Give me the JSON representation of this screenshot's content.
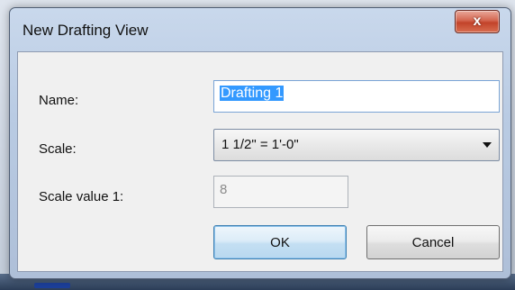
{
  "dialog": {
    "title": "New Drafting View",
    "close_glyph": "x"
  },
  "form": {
    "name_label": "Name:",
    "name_value": "Drafting 1",
    "scale_label": "Scale:",
    "scale_value": "1 1/2\" = 1'-0\"",
    "scale_value_label": "Scale value  1:",
    "scale_value_number": "8"
  },
  "buttons": {
    "ok_label": "OK",
    "cancel_label": "Cancel"
  },
  "icons": {
    "close": "close-icon",
    "dropdown": "chevron-down-icon"
  }
}
